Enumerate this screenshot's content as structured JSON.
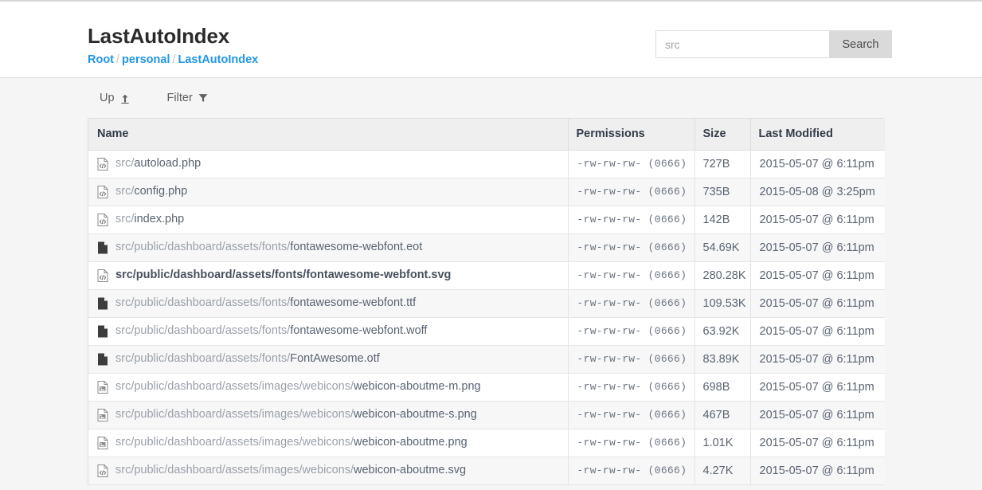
{
  "header": {
    "title": "LastAutoIndex",
    "breadcrumb": [
      {
        "label": "Root"
      },
      {
        "label": "personal"
      },
      {
        "label": "LastAutoIndex"
      }
    ],
    "breadcrumb_separator": "/",
    "search": {
      "value": "",
      "placeholder": "src",
      "button_label": "Search"
    }
  },
  "toolbar": {
    "up_label": "Up",
    "up_icon": "arrow-up-to-line-icon",
    "filter_label": "Filter",
    "filter_icon": "funnel-icon"
  },
  "table": {
    "columns": [
      "Name",
      "Permissions",
      "Size",
      "Last Modified"
    ],
    "rows": [
      {
        "name_dir": "src/",
        "name_base": "autoload.php",
        "icon": "code-file-icon",
        "permissions": "-rw-rw-rw- (0666)",
        "size": "727B",
        "modified": "2015-05-07 @ 6:11pm",
        "bold": false
      },
      {
        "name_dir": "src/",
        "name_base": "config.php",
        "icon": "code-file-icon",
        "permissions": "-rw-rw-rw- (0666)",
        "size": "735B",
        "modified": "2015-05-08 @ 3:25pm",
        "bold": false
      },
      {
        "name_dir": "src/",
        "name_base": "index.php",
        "icon": "code-file-icon",
        "permissions": "-rw-rw-rw- (0666)",
        "size": "142B",
        "modified": "2015-05-07 @ 6:11pm",
        "bold": false
      },
      {
        "name_dir": "src/public/dashboard/assets/fonts/",
        "name_base": "fontawesome-webfont.eot",
        "icon": "file-icon",
        "permissions": "-rw-rw-rw- (0666)",
        "size": "54.69K",
        "modified": "2015-05-07 @ 6:11pm",
        "bold": false
      },
      {
        "name_dir": "src/public/dashboard/assets/fonts/",
        "name_base": "fontawesome-webfont.svg",
        "icon": "code-file-icon",
        "permissions": "-rw-rw-rw- (0666)",
        "size": "280.28K",
        "modified": "2015-05-07 @ 6:11pm",
        "bold": true
      },
      {
        "name_dir": "src/public/dashboard/assets/fonts/",
        "name_base": "fontawesome-webfont.ttf",
        "icon": "file-icon",
        "permissions": "-rw-rw-rw- (0666)",
        "size": "109.53K",
        "modified": "2015-05-07 @ 6:11pm",
        "bold": false
      },
      {
        "name_dir": "src/public/dashboard/assets/fonts/",
        "name_base": "fontawesome-webfont.woff",
        "icon": "file-icon",
        "permissions": "-rw-rw-rw- (0666)",
        "size": "63.92K",
        "modified": "2015-05-07 @ 6:11pm",
        "bold": false
      },
      {
        "name_dir": "src/public/dashboard/assets/fonts/",
        "name_base": "FontAwesome.otf",
        "icon": "file-icon",
        "permissions": "-rw-rw-rw- (0666)",
        "size": "83.89K",
        "modified": "2015-05-07 @ 6:11pm",
        "bold": false
      },
      {
        "name_dir": "src/public/dashboard/assets/images/webicons/",
        "name_base": "webicon-aboutme-m.png",
        "icon": "image-file-icon",
        "permissions": "-rw-rw-rw- (0666)",
        "size": "698B",
        "modified": "2015-05-07 @ 6:11pm",
        "bold": false
      },
      {
        "name_dir": "src/public/dashboard/assets/images/webicons/",
        "name_base": "webicon-aboutme-s.png",
        "icon": "image-file-icon",
        "permissions": "-rw-rw-rw- (0666)",
        "size": "467B",
        "modified": "2015-05-07 @ 6:11pm",
        "bold": false
      },
      {
        "name_dir": "src/public/dashboard/assets/images/webicons/",
        "name_base": "webicon-aboutme.png",
        "icon": "image-file-icon",
        "permissions": "-rw-rw-rw- (0666)",
        "size": "1.01K",
        "modified": "2015-05-07 @ 6:11pm",
        "bold": false
      },
      {
        "name_dir": "src/public/dashboard/assets/images/webicons/",
        "name_base": "webicon-aboutme.svg",
        "icon": "code-file-icon",
        "permissions": "-rw-rw-rw- (0666)",
        "size": "4.27K",
        "modified": "2015-05-07 @ 6:11pm",
        "bold": false
      }
    ]
  },
  "colors": {
    "link": "#2196e3",
    "page_background": "#f5f5f5",
    "header_background": "#ffffff",
    "table_header_background": "#efefef",
    "row_alt_background": "#f7f7f7",
    "text": "#5a6472"
  }
}
